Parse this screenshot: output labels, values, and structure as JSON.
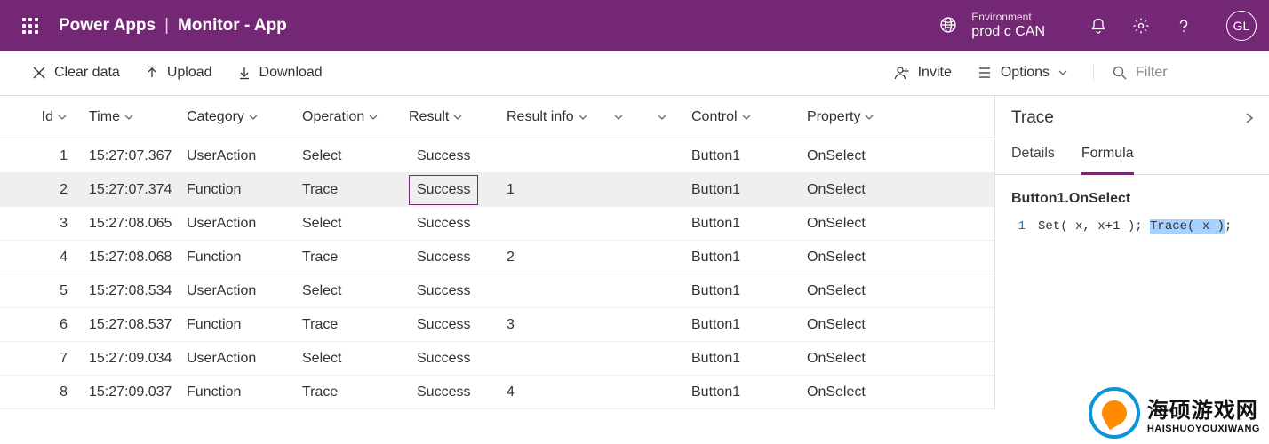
{
  "header": {
    "product": "Power Apps",
    "separator": "|",
    "page": "Monitor - App",
    "env_label": "Environment",
    "env_name": "prod c CAN",
    "avatar_initials": "GL"
  },
  "toolbar": {
    "clear_data": "Clear data",
    "upload": "Upload",
    "download": "Download",
    "invite": "Invite",
    "options": "Options",
    "filter_placeholder": "Filter"
  },
  "columns": {
    "id": "Id",
    "time": "Time",
    "category": "Category",
    "operation": "Operation",
    "result": "Result",
    "result_info": "Result info",
    "control": "Control",
    "property": "Property"
  },
  "rows": [
    {
      "id": "1",
      "time": "15:27:07.367",
      "category": "UserAction",
      "operation": "Select",
      "result": "Success",
      "result_info": "",
      "control": "Button1",
      "property": "OnSelect",
      "selected": false
    },
    {
      "id": "2",
      "time": "15:27:07.374",
      "category": "Function",
      "operation": "Trace",
      "result": "Success",
      "result_info": "1",
      "control": "Button1",
      "property": "OnSelect",
      "selected": true
    },
    {
      "id": "3",
      "time": "15:27:08.065",
      "category": "UserAction",
      "operation": "Select",
      "result": "Success",
      "result_info": "",
      "control": "Button1",
      "property": "OnSelect",
      "selected": false
    },
    {
      "id": "4",
      "time": "15:27:08.068",
      "category": "Function",
      "operation": "Trace",
      "result": "Success",
      "result_info": "2",
      "control": "Button1",
      "property": "OnSelect",
      "selected": false
    },
    {
      "id": "5",
      "time": "15:27:08.534",
      "category": "UserAction",
      "operation": "Select",
      "result": "Success",
      "result_info": "",
      "control": "Button1",
      "property": "OnSelect",
      "selected": false
    },
    {
      "id": "6",
      "time": "15:27:08.537",
      "category": "Function",
      "operation": "Trace",
      "result": "Success",
      "result_info": "3",
      "control": "Button1",
      "property": "OnSelect",
      "selected": false
    },
    {
      "id": "7",
      "time": "15:27:09.034",
      "category": "UserAction",
      "operation": "Select",
      "result": "Success",
      "result_info": "",
      "control": "Button1",
      "property": "OnSelect",
      "selected": false
    },
    {
      "id": "8",
      "time": "15:27:09.037",
      "category": "Function",
      "operation": "Trace",
      "result": "Success",
      "result_info": "4",
      "control": "Button1",
      "property": "OnSelect",
      "selected": false
    }
  ],
  "panel": {
    "title": "Trace",
    "tabs": {
      "details": "Details",
      "formula": "Formula"
    },
    "formula_ref": "Button1.OnSelect",
    "code": {
      "line_no": "1",
      "prefix": "Set( x, x+1 ); ",
      "highlight": "Trace( x )",
      "suffix": ";"
    }
  },
  "watermark": {
    "cn": "海硕游戏网",
    "en": "HAISHUOYOUXIWANG"
  }
}
